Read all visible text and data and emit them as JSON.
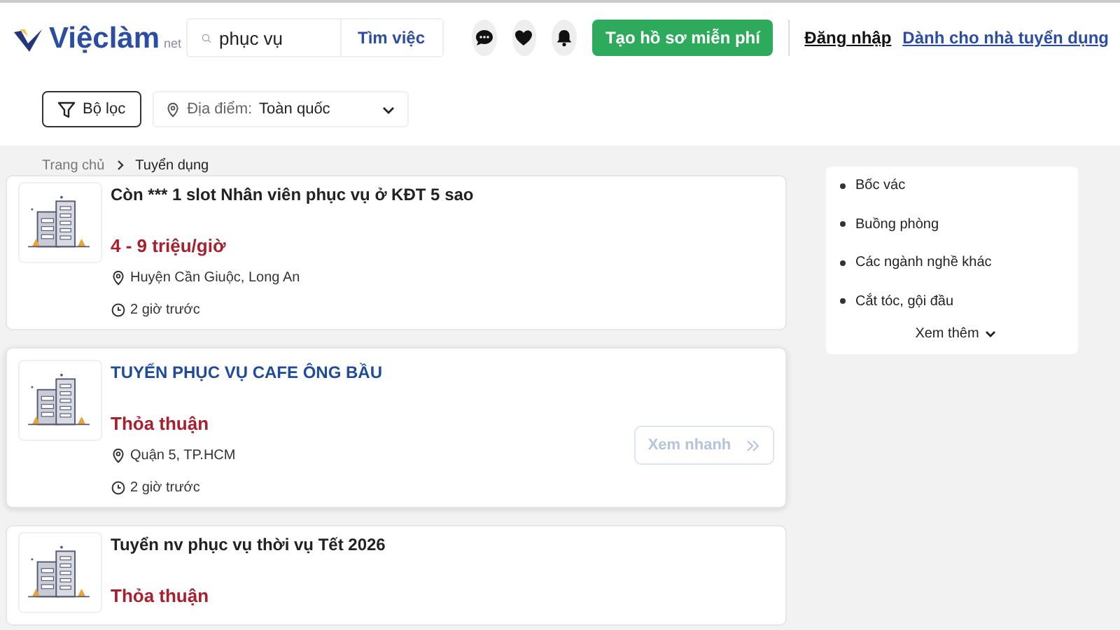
{
  "header": {
    "logo": {
      "name": "Việclàm",
      "suffix": "net"
    },
    "search": {
      "value": "phục vụ",
      "button": "Tìm việc"
    },
    "create_cv": "Tạo hồ sơ miễn phí",
    "login": "Đăng nhập",
    "employer_link": "Dành cho nhà tuyển dụng"
  },
  "filters": {
    "filter_button": "Bộ lọc",
    "location_label": "Địa điểm:",
    "location_value": "Toàn quốc"
  },
  "breadcrumb": [
    "Trang chủ",
    "Tuyển dụng"
  ],
  "jobs": [
    {
      "title": "Còn *** 1 slot Nhân viên phục vụ ở KĐT 5 sao",
      "salary": "4 - 9 triệu/giờ",
      "location": "Huyện Cần Giuộc, Long An",
      "posted": "2 giờ trước",
      "hovered": false
    },
    {
      "title": "TUYỂN PHỤC VỤ CAFE ÔNG BẦU",
      "salary": "Thỏa thuận",
      "location": "Quận 5, TP.HCM",
      "posted": "2 giờ trước",
      "hovered": true,
      "quick_view": "Xem nhanh"
    },
    {
      "title": "Tuyển nv phục vụ thời vụ Tết 2026",
      "salary": "Thỏa thuận",
      "hovered": false
    }
  ],
  "sidebar": {
    "items": [
      "Bốc vác",
      "Buồng phòng",
      "Các ngành nghề khác",
      "Cắt tóc, gội đầu"
    ],
    "more": "Xem thêm"
  }
}
